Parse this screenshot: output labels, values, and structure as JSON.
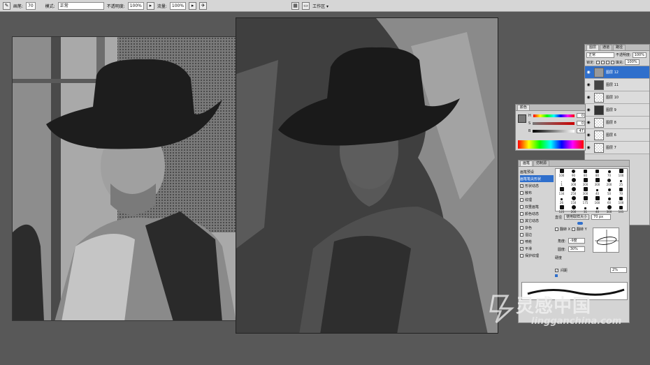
{
  "options_bar": {
    "brush_label": "画笔:",
    "brush_size": "70",
    "mode_label": "模式:",
    "mode_value": "正常",
    "opacity_label": "不透明度:",
    "opacity_value": "100%",
    "flow_label": "流量:",
    "flow_value": "100%",
    "workspace_label": "工作区 ▾"
  },
  "layers_panel": {
    "tabs": [
      "图层",
      "通道",
      "路径"
    ],
    "blend_mode": "正常",
    "opacity_label": "不透明度:",
    "opacity_value": "100%",
    "lock_label": "锁定:",
    "fill_label": "填充:",
    "fill_value": "100%",
    "layers": [
      {
        "name": "图层 12",
        "selected": true
      },
      {
        "name": "图层 11",
        "selected": false
      },
      {
        "name": "图层 10",
        "selected": false
      },
      {
        "name": "图层 9",
        "selected": false
      },
      {
        "name": "图层 8",
        "selected": false
      },
      {
        "name": "图层 6",
        "selected": false
      },
      {
        "name": "图层 7",
        "selected": false
      }
    ]
  },
  "color_panel": {
    "tab": "颜色",
    "channels": [
      {
        "label": "H",
        "value": "0"
      },
      {
        "label": "S",
        "value": "0"
      },
      {
        "label": "B",
        "value": "47"
      }
    ]
  },
  "brushes_panel": {
    "tabs": [
      "画笔",
      "仿制源"
    ],
    "preset_label": "画笔预设",
    "options": [
      {
        "label": "画笔笔尖形状",
        "checked": false,
        "highlight": true
      },
      {
        "label": "形状动态",
        "checked": true
      },
      {
        "label": "散布",
        "checked": false
      },
      {
        "label": "纹理",
        "checked": false
      },
      {
        "label": "双重画笔",
        "checked": false
      },
      {
        "label": "颜色动态",
        "checked": false
      },
      {
        "label": "其它动态",
        "checked": true
      },
      {
        "label": "杂色",
        "checked": false
      },
      {
        "label": "湿边",
        "checked": false
      },
      {
        "label": "喷枪",
        "checked": false
      },
      {
        "label": "平滑",
        "checked": true
      },
      {
        "label": "保护纹理",
        "checked": false
      }
    ],
    "tips": [
      "100",
      "90",
      "80",
      "80",
      "70",
      "100",
      "1",
      "300",
      "300",
      "300",
      "200",
      "25",
      "134",
      "250",
      "300",
      "40",
      "50",
      "70",
      "26",
      "150",
      "175",
      "160",
      "60",
      "100",
      "125",
      "200",
      "31",
      "40",
      "300",
      "101"
    ],
    "diameter_label": "直径",
    "use_sample_label": "使用取样大小",
    "diameter_value": "70 px",
    "flip_x_label": "翻转 X",
    "flip_y_label": "翻转 Y",
    "angle_label": "角度:",
    "angle_value": "-9度",
    "roundness_label": "圆度:",
    "roundness_value": "30%",
    "hardness_label": "硬度",
    "spacing_label": "间距",
    "spacing_value": "2%"
  },
  "watermark": {
    "brand": "灵感中国",
    "url": "lingganchina.com"
  }
}
